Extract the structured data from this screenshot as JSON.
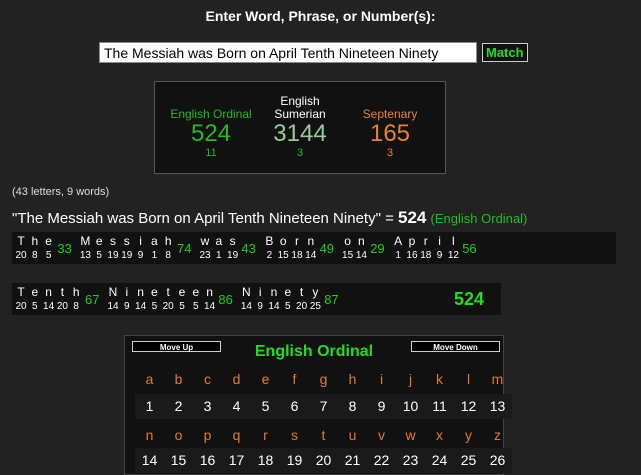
{
  "prompt": "Enter Word, Phrase, or Number(s):",
  "input_value": "The Messiah was Born on April Tenth Nineteen Ninety",
  "match_label": "Match",
  "results": [
    {
      "name1": "",
      "name2": "English Ordinal",
      "value": "524",
      "reduction": "11",
      "color": "#22bb22"
    },
    {
      "name1": "English",
      "name2": "Sumerian",
      "value": "3144",
      "reduction": "3",
      "color": "#99cc99"
    },
    {
      "name1": "",
      "name2": "Septenary",
      "value": "165",
      "reduction": "3",
      "color": "#e8803a"
    }
  ],
  "stats": "(43 letters, 9 words)",
  "sentence": {
    "quoted": "\"The Messiah was Born on April Tenth Nineteen Ninety\" = ",
    "value": "524",
    "cipher": "(English Ordinal)"
  },
  "words": [
    {
      "letters": [
        "T",
        "h",
        "e"
      ],
      "nums": [
        "20",
        "8",
        "5"
      ],
      "total": "33"
    },
    {
      "letters": [
        "M",
        "e",
        "s",
        "s",
        "i",
        "a",
        "h"
      ],
      "nums": [
        "13",
        "5",
        "19",
        "19",
        "9",
        "1",
        "8"
      ],
      "total": "74"
    },
    {
      "letters": [
        "w",
        "a",
        "s"
      ],
      "nums": [
        "23",
        "1",
        "19"
      ],
      "total": "43"
    },
    {
      "letters": [
        "B",
        "o",
        "r",
        "n"
      ],
      "nums": [
        "2",
        "15",
        "18",
        "14"
      ],
      "total": "49"
    },
    {
      "letters": [
        "o",
        "n"
      ],
      "nums": [
        "15",
        "14"
      ],
      "total": "29"
    },
    {
      "letters": [
        "A",
        "p",
        "r",
        "i",
        "l"
      ],
      "nums": [
        "1",
        "16",
        "18",
        "9",
        "12"
      ],
      "total": "56"
    },
    {
      "letters": [
        "T",
        "e",
        "n",
        "t",
        "h"
      ],
      "nums": [
        "20",
        "5",
        "14",
        "20",
        "8"
      ],
      "total": "67"
    },
    {
      "letters": [
        "N",
        "i",
        "n",
        "e",
        "t",
        "e",
        "e",
        "n"
      ],
      "nums": [
        "14",
        "9",
        "14",
        "5",
        "20",
        "5",
        "5",
        "14"
      ],
      "total": "86"
    },
    {
      "letters": [
        "N",
        "i",
        "n",
        "e",
        "t",
        "y"
      ],
      "nums": [
        "14",
        "9",
        "14",
        "5",
        "20",
        "25"
      ],
      "total": "87"
    }
  ],
  "grand_total": "524",
  "chart": {
    "title": "English Ordinal",
    "move_up": "Move Up",
    "move_down": "Move Down",
    "letters_row1": [
      "a",
      "b",
      "c",
      "d",
      "e",
      "f",
      "g",
      "h",
      "i",
      "j",
      "k",
      "l",
      "m"
    ],
    "nums_row1": [
      "1",
      "2",
      "3",
      "4",
      "5",
      "6",
      "7",
      "8",
      "9",
      "10",
      "11",
      "12",
      "13"
    ],
    "letters_row2": [
      "n",
      "o",
      "p",
      "q",
      "r",
      "s",
      "t",
      "u",
      "v",
      "w",
      "x",
      "y",
      "z"
    ],
    "nums_row2": [
      "14",
      "15",
      "16",
      "17",
      "18",
      "19",
      "20",
      "21",
      "22",
      "23",
      "24",
      "25",
      "26"
    ]
  }
}
